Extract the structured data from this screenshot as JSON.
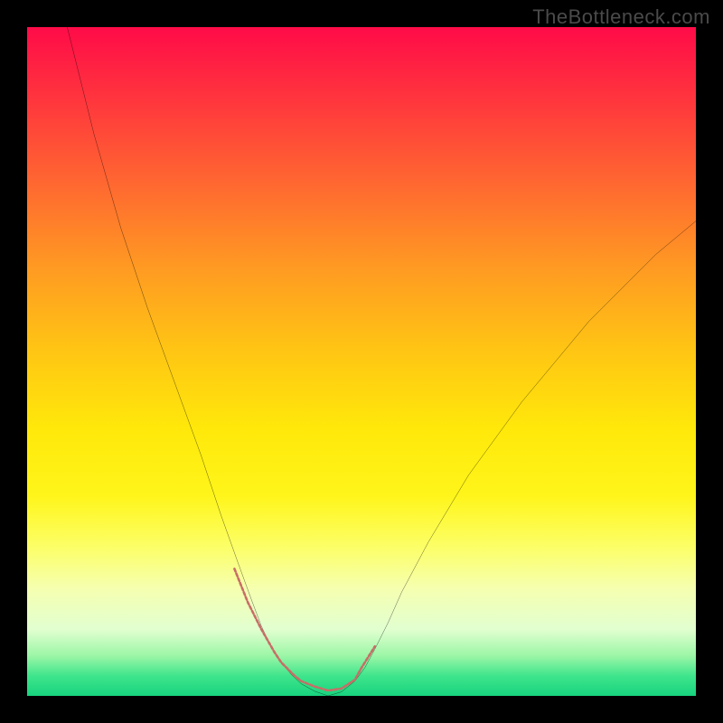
{
  "watermark": "TheBottleneck.com",
  "chart_data": {
    "type": "line",
    "title": "",
    "xlabel": "",
    "ylabel": "",
    "xlim": [
      0,
      100
    ],
    "ylim": [
      0,
      100
    ],
    "series": [
      {
        "name": "curve-left",
        "x": [
          6,
          10,
          14,
          18,
          22,
          26,
          29,
          31.5,
          33.5,
          35,
          36.5,
          38,
          39.5,
          41,
          43,
          45
        ],
        "values": [
          100,
          84,
          70,
          58,
          47,
          36,
          27,
          20,
          14.5,
          10.5,
          7.3,
          5,
          3.2,
          1.8,
          0.7,
          0
        ]
      },
      {
        "name": "curve-right",
        "x": [
          45,
          47,
          49,
          50.5,
          52,
          54,
          56,
          60,
          66,
          74,
          84,
          94,
          100
        ],
        "values": [
          0,
          0.6,
          2.2,
          4.2,
          7,
          11,
          15.5,
          23,
          33,
          44,
          56,
          66,
          71
        ]
      },
      {
        "name": "marker-band",
        "x": [
          31,
          33,
          35,
          37,
          38,
          40,
          41,
          43,
          45,
          47,
          49,
          50,
          52
        ],
        "values": [
          19,
          14,
          10,
          6.5,
          5,
          3,
          2.2,
          1.4,
          0.8,
          1.1,
          2.4,
          4.2,
          7.4
        ]
      }
    ],
    "colors": {
      "curve": "#000000",
      "marker": "#c86d67",
      "gradient_top": "#ff0b48",
      "gradient_bottom": "#17d37e"
    }
  }
}
